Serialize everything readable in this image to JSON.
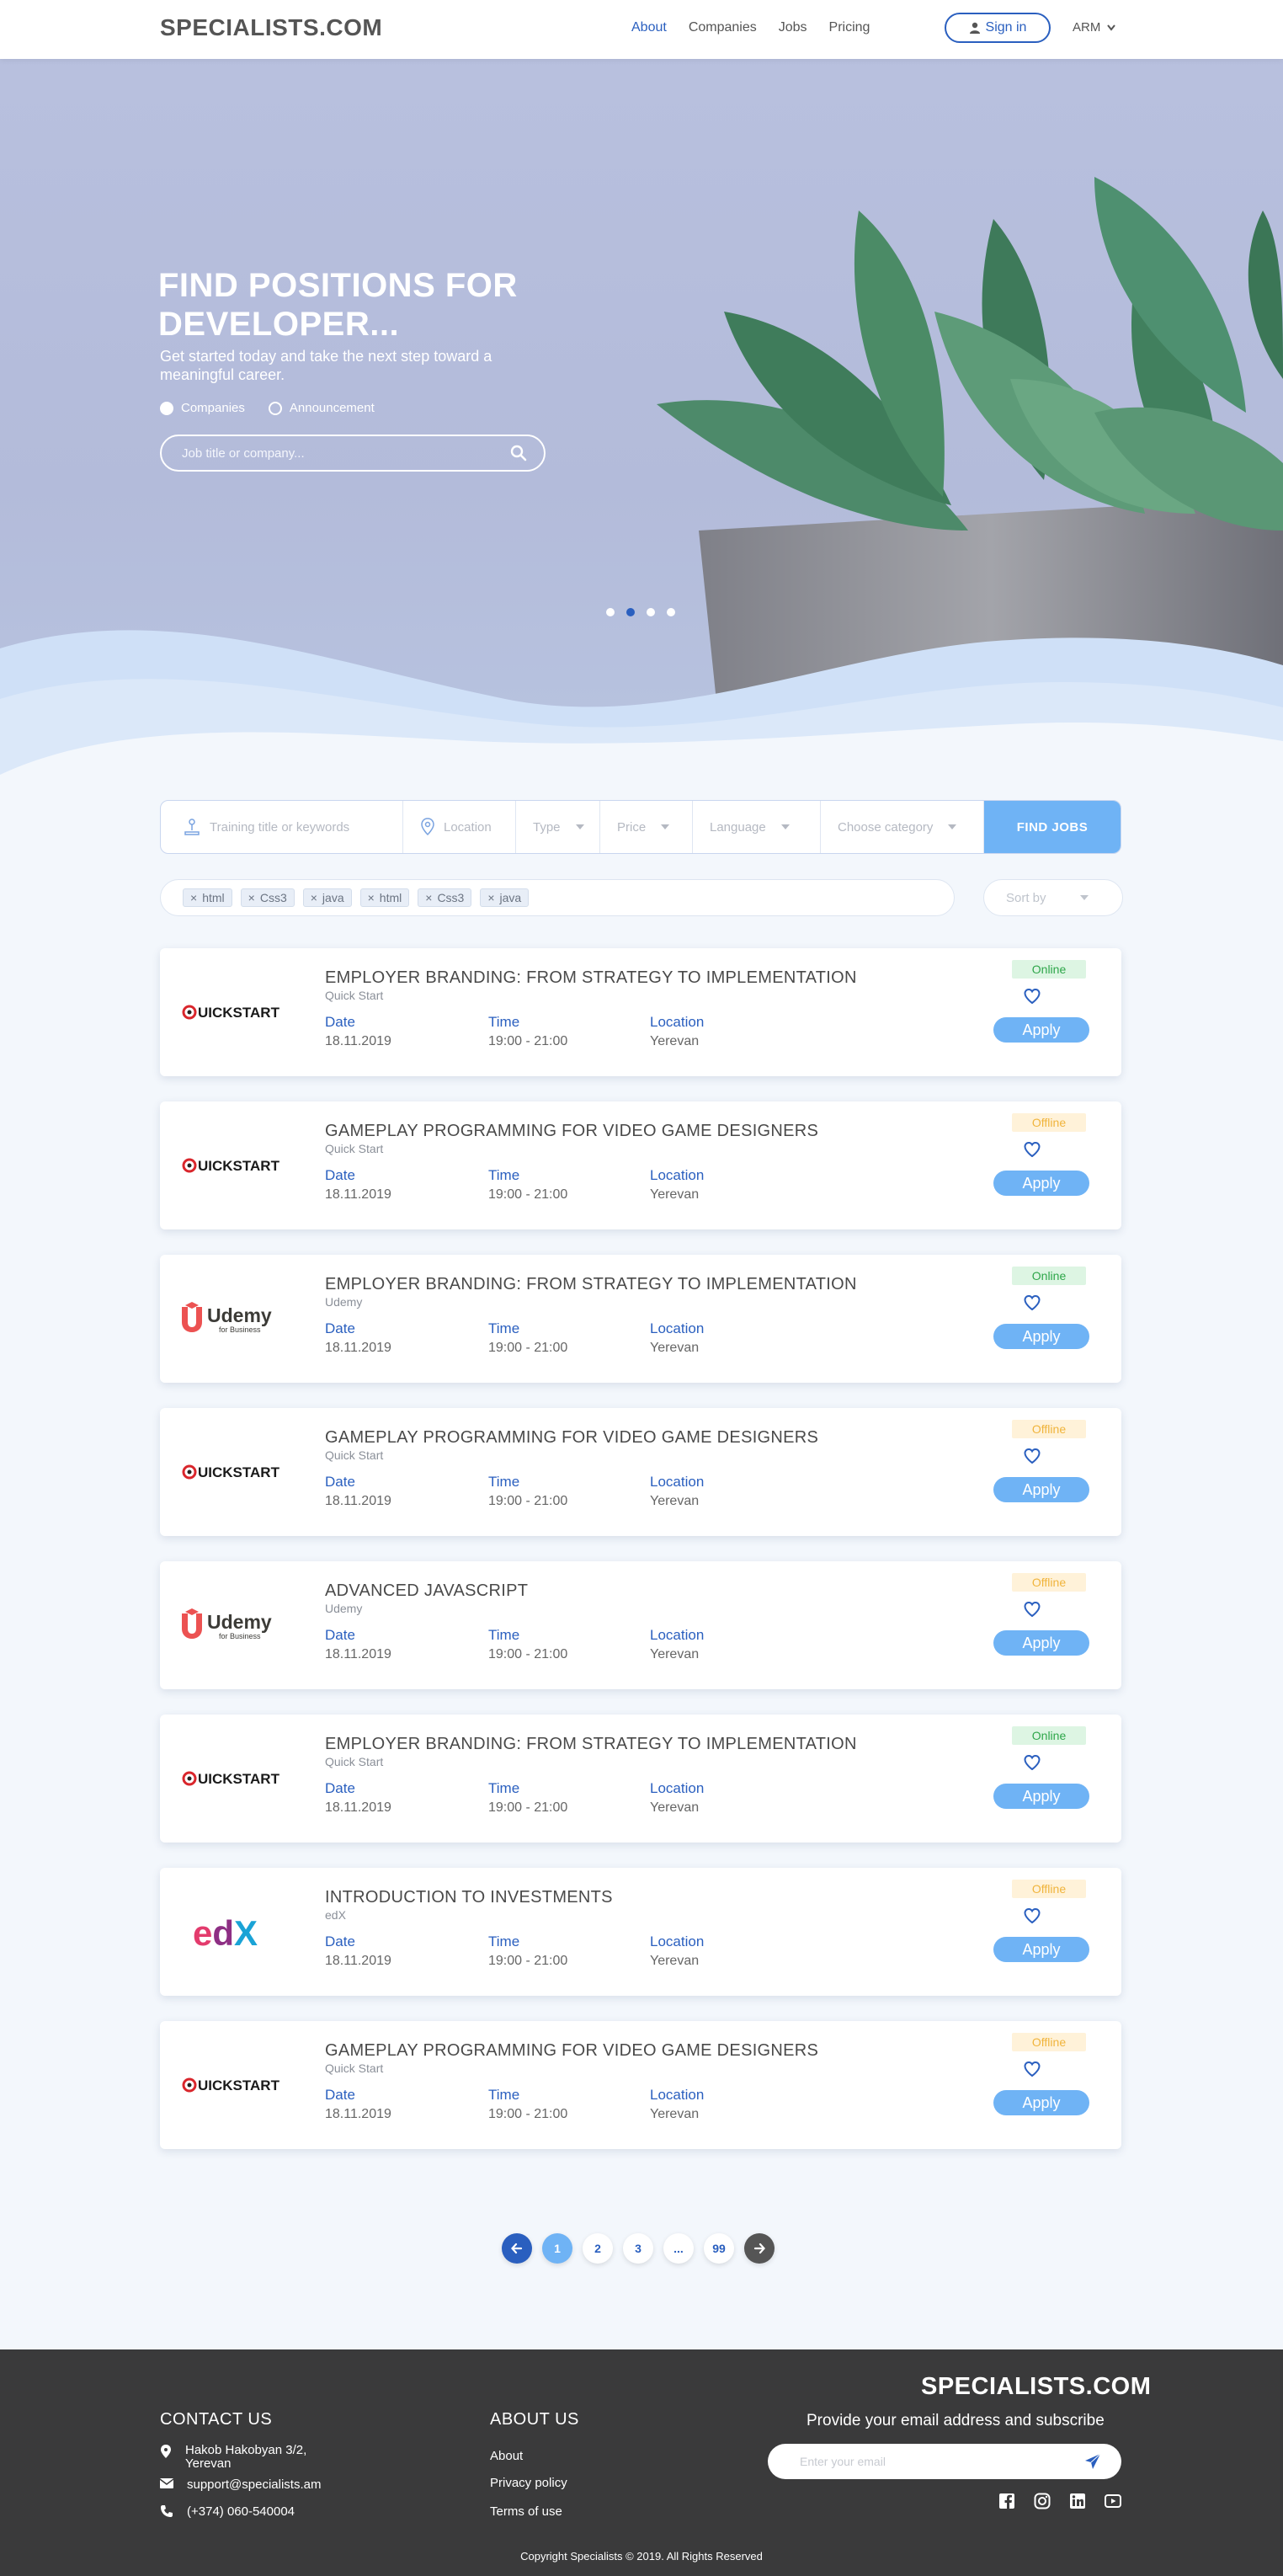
{
  "header": {
    "logo": "SPECIALISTS.COM",
    "nav": [
      {
        "label": "About",
        "active": true
      },
      {
        "label": "Companies",
        "active": false
      },
      {
        "label": "Jobs",
        "active": false
      },
      {
        "label": "Pricing",
        "active": false
      }
    ],
    "signin_label": "Sign in",
    "language": "ARM"
  },
  "hero": {
    "title": "FIND POSITIONS FOR DEVELOPER...",
    "subtitle": "Get started today and take the next step toward a meaningful career.",
    "radio_companies": "Companies",
    "radio_announcement": "Announcement",
    "search_placeholder": "Job title or company...",
    "slides": 4,
    "active_slide": 2
  },
  "filters": {
    "keywords_placeholder": "Training title or keywords",
    "location_placeholder": "Location",
    "type": "Type",
    "price": "Price",
    "language": "Language",
    "category": "Choose category",
    "find_label": "FIND JOBS",
    "tags": [
      "html",
      "Css3",
      "java",
      "html",
      "Css3",
      "java"
    ],
    "sort_label": "Sort by"
  },
  "labels": {
    "date": "Date",
    "time": "Time",
    "location": "Location",
    "apply": "Apply"
  },
  "jobs": [
    {
      "title": "EMPLOYER BRANDING: FROM STRATEGY TO IMPLEMENTATION",
      "company": "Quick Start",
      "logo": "quickstart",
      "date": "18.11.2019",
      "time": "19:00 - 21:00",
      "location": "Yerevan",
      "status": "Online"
    },
    {
      "title": "GAMEPLAY PROGRAMMING FOR VIDEO GAME DESIGNERS",
      "company": "Quick Start",
      "logo": "quickstart",
      "date": "18.11.2019",
      "time": "19:00 - 21:00",
      "location": "Yerevan",
      "status": "Offline"
    },
    {
      "title": "EMPLOYER BRANDING: FROM STRATEGY TO IMPLEMENTATION",
      "company": "Udemy",
      "logo": "udemy",
      "date": "18.11.2019",
      "time": "19:00 - 21:00",
      "location": "Yerevan",
      "status": "Online"
    },
    {
      "title": "GAMEPLAY PROGRAMMING FOR VIDEO GAME DESIGNERS",
      "company": "Quick Start",
      "logo": "quickstart",
      "date": "18.11.2019",
      "time": "19:00 - 21:00",
      "location": "Yerevan",
      "status": "Offline"
    },
    {
      "title": "ADVANCED JAVASCRIPT",
      "company": "Udemy",
      "logo": "udemy",
      "date": "18.11.2019",
      "time": "19:00 - 21:00",
      "location": "Yerevan",
      "status": "Offline"
    },
    {
      "title": "EMPLOYER BRANDING: FROM STRATEGY TO IMPLEMENTATION",
      "company": "Quick Start",
      "logo": "quickstart",
      "date": "18.11.2019",
      "time": "19:00 - 21:00",
      "location": "Yerevan",
      "status": "Online"
    },
    {
      "title": "INTRODUCTION TO INVESTMENTS",
      "company": "edX",
      "logo": "edx",
      "date": "18.11.2019",
      "time": "19:00 - 21:00",
      "location": "Yerevan",
      "status": "Offline"
    },
    {
      "title": "GAMEPLAY PROGRAMMING FOR VIDEO GAME DESIGNERS",
      "company": "Quick Start",
      "logo": "quickstart",
      "date": "18.11.2019",
      "time": "19:00 - 21:00",
      "location": "Yerevan",
      "status": "Offline"
    }
  ],
  "logo_text": {
    "quickstart": "QUICKSTART",
    "udemy": "Udemy",
    "udemy_sub": "for Business",
    "edx": "edX"
  },
  "pagination": {
    "pages": [
      "1",
      "2",
      "3",
      "...",
      "99"
    ],
    "active": "1"
  },
  "footer": {
    "contact_title": "CONTACT US",
    "address_line1": "Hakob Hakobyan 3/2,",
    "address_line2": "Yerevan",
    "email": "support@specialists.am",
    "phone": "(+374) 060-540004",
    "about_title": "ABOUT US",
    "links": [
      "About",
      "Privacy policy",
      "Terms of use"
    ],
    "logo": "SPECIALISTS.COM",
    "subscribe_text": "Provide your email address and subscribe",
    "email_placeholder": "Enter your email",
    "socials": [
      "facebook-icon",
      "instagram-icon",
      "linkedin-icon",
      "youtube-icon"
    ],
    "copyright": "Copyright Specialists © 2019. All Rights Reserved"
  },
  "colors": {
    "primary": "#2a5fbf",
    "accent": "#6fb3f5",
    "online": "#2ea64a",
    "offline": "#f0b43c",
    "footer": "#3a3a3b"
  }
}
